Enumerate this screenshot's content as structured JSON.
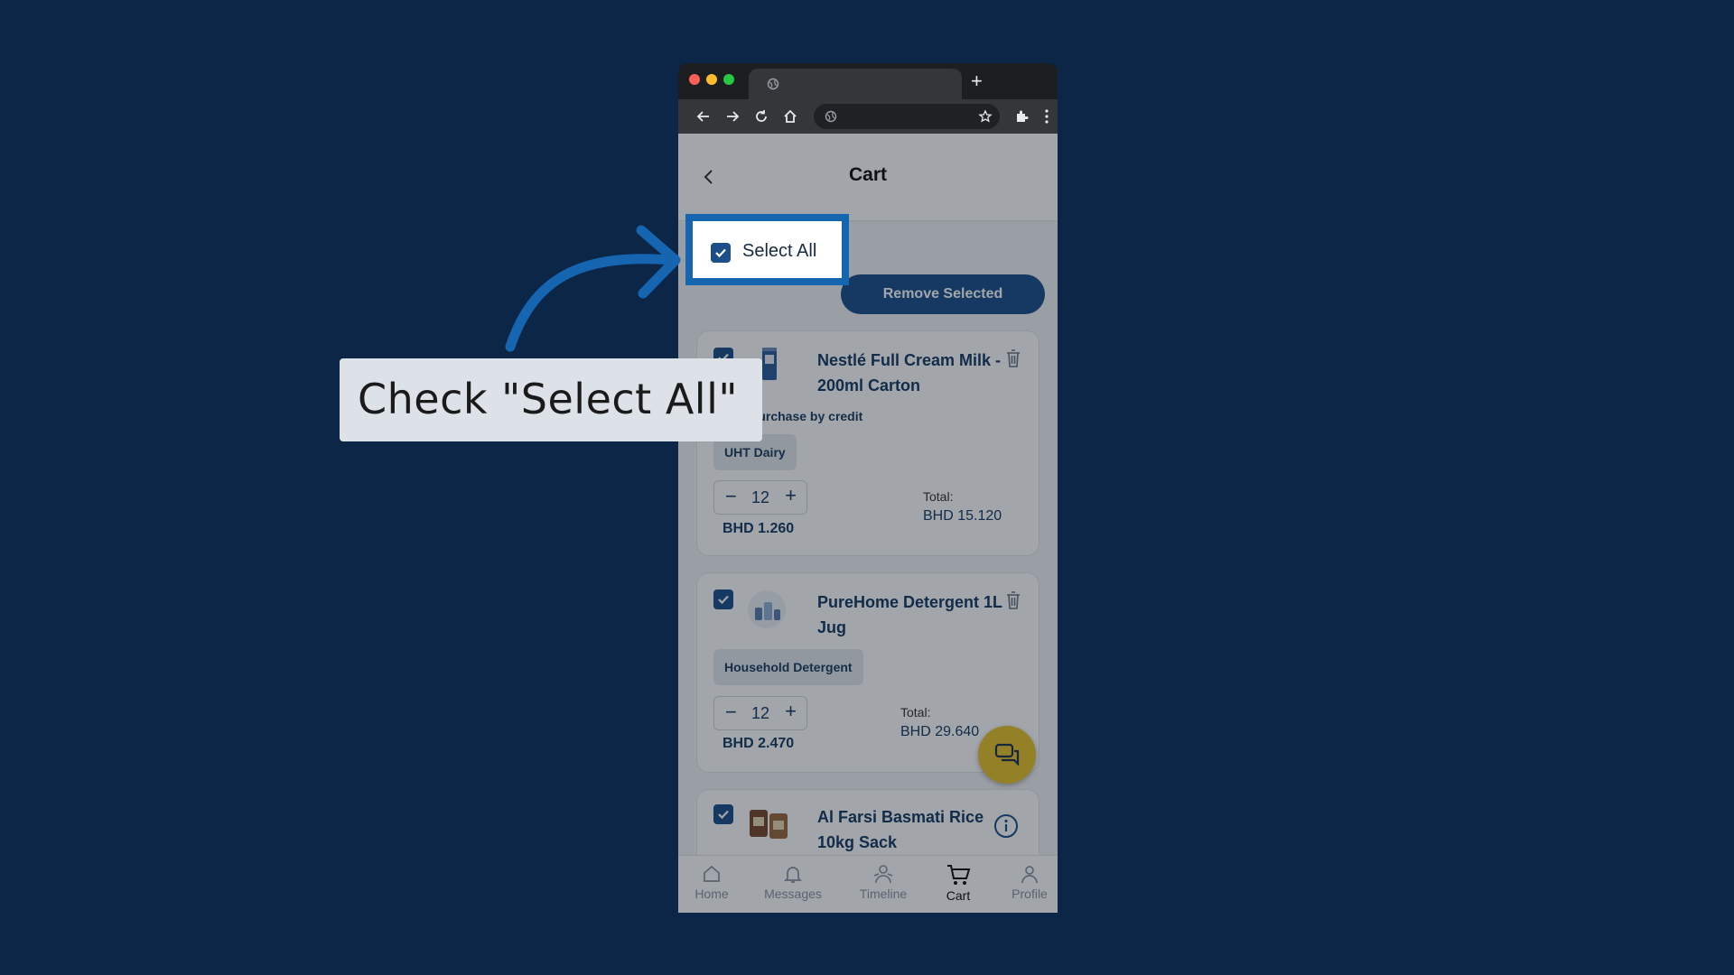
{
  "app": {
    "title": "Cart",
    "select_all_label": "Select All",
    "remove_selected_label": "Remove Selected",
    "items": [
      {
        "name": "Nestlé Full Cream Milk - 200ml Carton",
        "credit_label": "Purchase by credit",
        "category": "UHT Dairy",
        "quantity": "12",
        "unit_price": "BHD 1.260",
        "total_label": "Total:",
        "total": "BHD 15.120",
        "checked": true
      },
      {
        "name": "PureHome Detergent 1L Jug",
        "category": "Household Detergent",
        "quantity": "12",
        "unit_price": "BHD 2.470",
        "total_label": "Total:",
        "total": "BHD 29.640",
        "checked": true
      },
      {
        "name": "Al Farsi Basmati Rice 10kg Sack",
        "checked": true,
        "icon": "info-icon"
      }
    ],
    "nav": {
      "home": "Home",
      "messages": "Messages",
      "timeline": "Timeline",
      "cart": "Cart",
      "profile": "Profile"
    }
  },
  "tutorial": {
    "instruction": "Check \"Select All\""
  },
  "colors": {
    "background": "#0b2647",
    "primary": "#1c4f8a",
    "highlight_border": "#1565b0",
    "fab": "#e9c42a"
  }
}
